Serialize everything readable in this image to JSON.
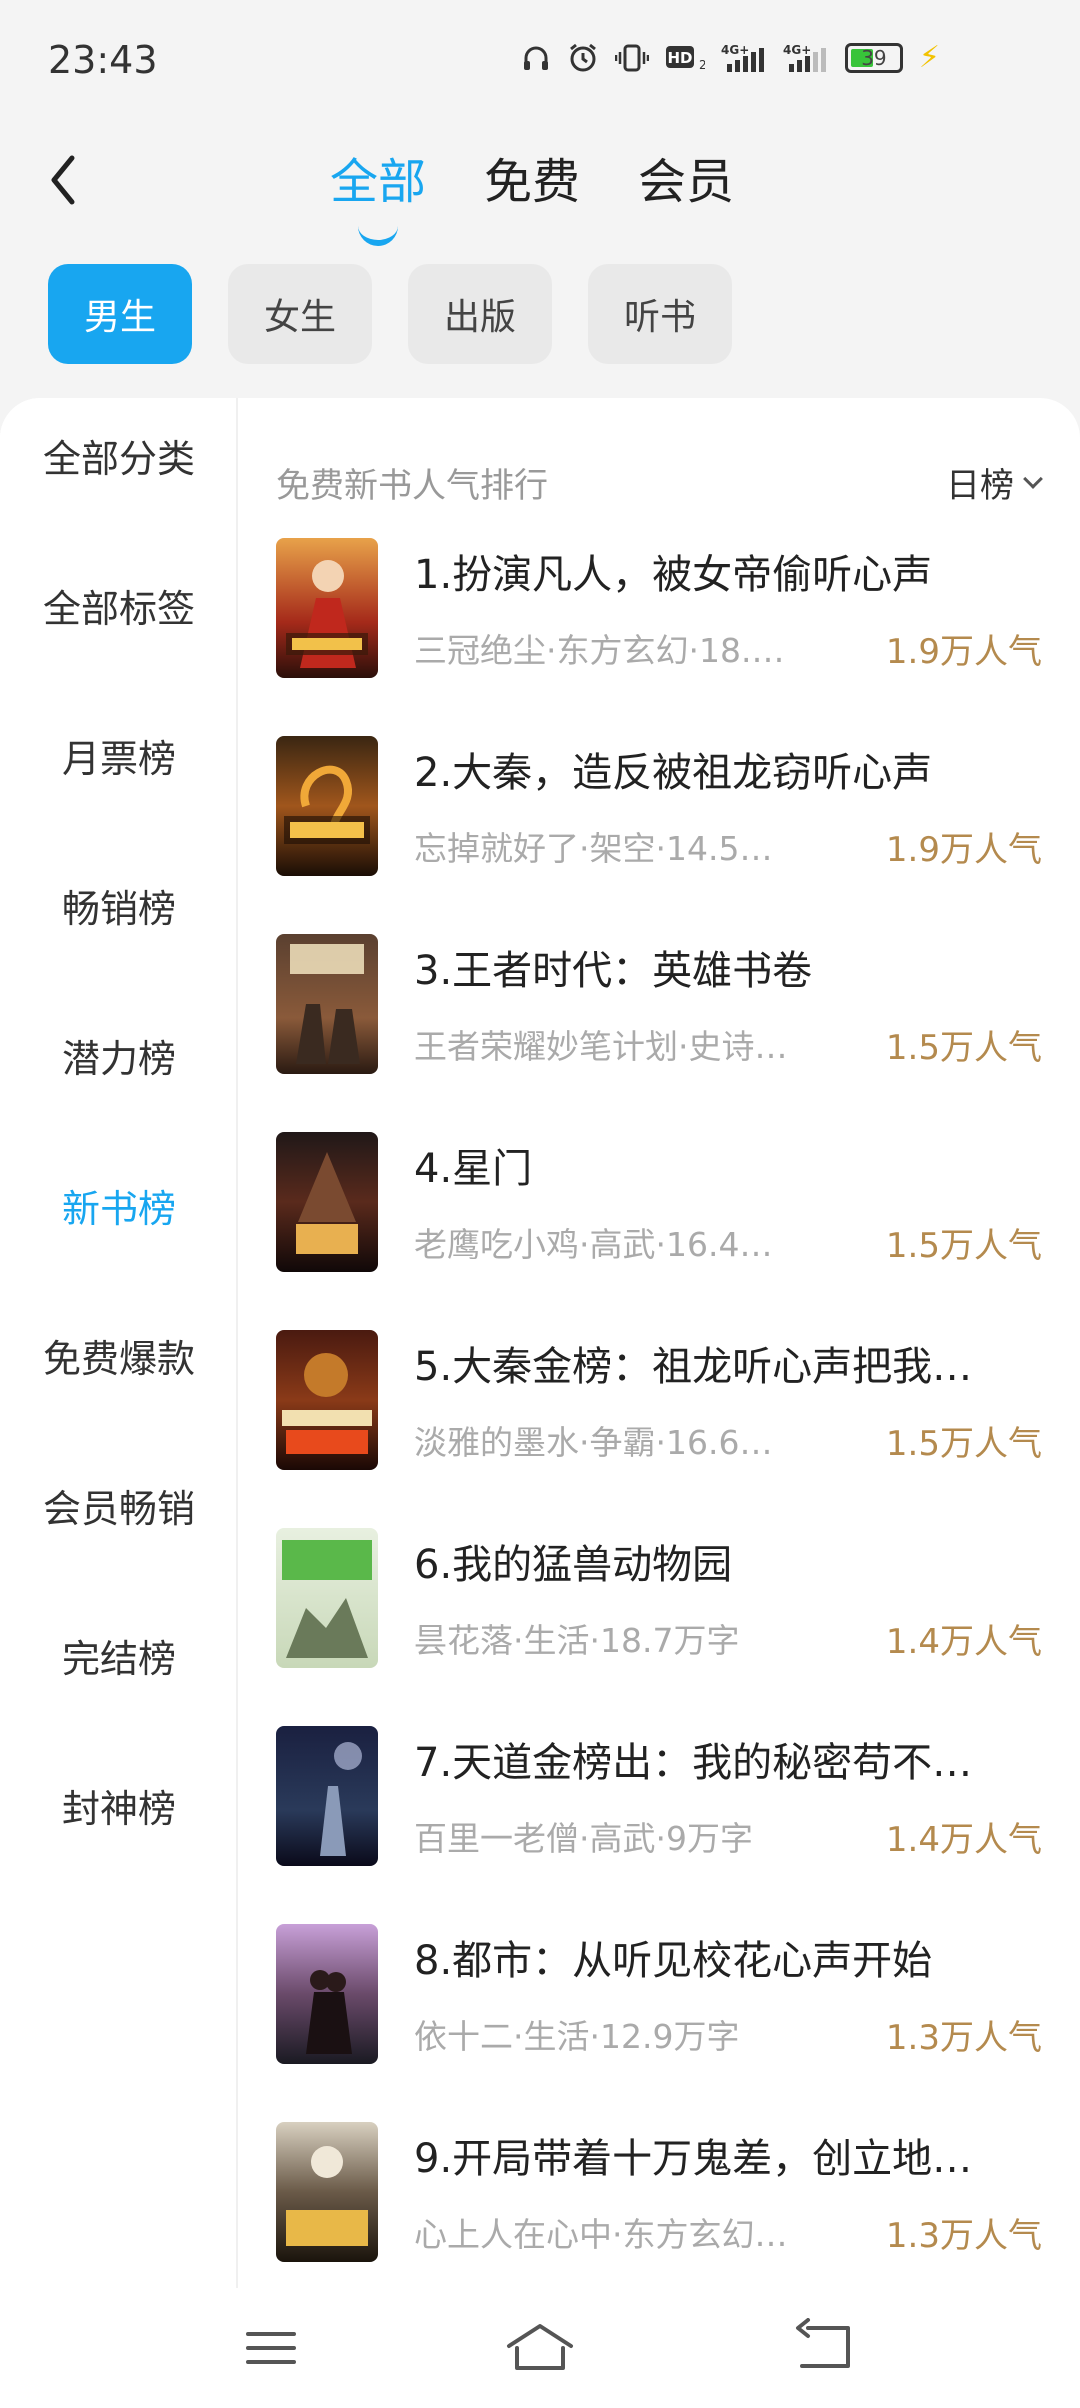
{
  "status": {
    "time": "23:43",
    "battery": "39"
  },
  "header": {
    "tabs": [
      {
        "label": "全部",
        "active": true
      },
      {
        "label": "免费",
        "active": false
      },
      {
        "label": "会员",
        "active": false
      }
    ]
  },
  "chips": [
    {
      "label": "男生",
      "active": true
    },
    {
      "label": "女生",
      "active": false
    },
    {
      "label": "出版",
      "active": false
    },
    {
      "label": "听书",
      "active": false
    }
  ],
  "sidebar": {
    "items": [
      {
        "label": "全部分类",
        "active": false
      },
      {
        "label": "全部标签",
        "active": false
      },
      {
        "label": "月票榜",
        "active": false
      },
      {
        "label": "畅销榜",
        "active": false
      },
      {
        "label": "潜力榜",
        "active": false
      },
      {
        "label": "新书榜",
        "active": true
      },
      {
        "label": "免费爆款",
        "active": false
      },
      {
        "label": "会员畅销",
        "active": false
      },
      {
        "label": "完结榜",
        "active": false
      },
      {
        "label": "封神榜",
        "active": false
      }
    ]
  },
  "list": {
    "title": "免费新书人气排行",
    "sort_label": "日榜",
    "books": [
      {
        "title": "1.扮演凡人，被女帝偷听心声",
        "meta": "三冠绝尘·东方玄幻·18.…",
        "popularity": "1.9万人气",
        "cover_icon": "cover-1"
      },
      {
        "title": "2.大秦，造反被祖龙窃听心声",
        "meta": "忘掉就好了·架空·14.5…",
        "popularity": "1.9万人气",
        "cover_icon": "cover-2"
      },
      {
        "title": "3.王者时代：英雄书卷",
        "meta": "王者荣耀妙笔计划·史诗…",
        "popularity": "1.5万人气",
        "cover_icon": "cover-3"
      },
      {
        "title": "4.星门",
        "meta": "老鹰吃小鸡·高武·16.4…",
        "popularity": "1.5万人气",
        "cover_icon": "cover-4"
      },
      {
        "title": "5.大秦金榜：祖龙听心声把我…",
        "meta": "淡雅的墨水·争霸·16.6…",
        "popularity": "1.5万人气",
        "cover_icon": "cover-5"
      },
      {
        "title": "6.我的猛兽动物园",
        "meta": "昙花落·生活·18.7万字",
        "popularity": "1.4万人气",
        "cover_icon": "cover-6"
      },
      {
        "title": "7.天道金榜出：我的秘密苟不…",
        "meta": "百里一老僧·高武·9万字",
        "popularity": "1.4万人气",
        "cover_icon": "cover-7"
      },
      {
        "title": "8.都市：从听见校花心声开始",
        "meta": "依十二·生活·12.9万字",
        "popularity": "1.3万人气",
        "cover_icon": "cover-8"
      },
      {
        "title": "9.开局带着十万鬼差，创立地…",
        "meta": "心上人在心中·东方玄幻…",
        "popularity": "1.3万人气",
        "cover_icon": "cover-9"
      }
    ]
  },
  "colors": {
    "accent": "#18a6f0",
    "popularity": "#b48a4e"
  }
}
